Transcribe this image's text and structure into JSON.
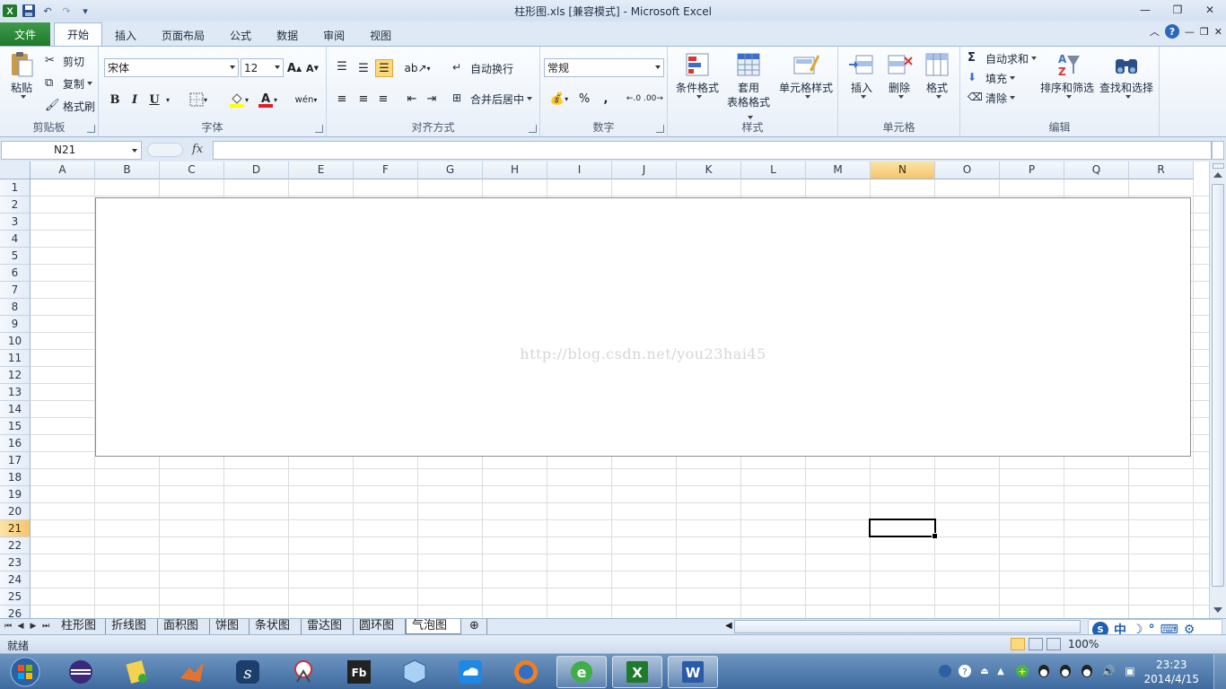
{
  "window": {
    "title": "柱形图.xls  [兼容模式]  -  Microsoft Excel",
    "controls": {
      "minimize": "—",
      "restore": "❐",
      "close": "✕"
    }
  },
  "ribbon_tabs": [
    "文件",
    "开始",
    "插入",
    "页面布局",
    "公式",
    "数据",
    "审阅",
    "视图"
  ],
  "clipboard": {
    "paste": "粘贴",
    "cut": "剪切",
    "copy": "复制",
    "format_painter": "格式刷",
    "label": "剪贴板"
  },
  "font": {
    "name": "宋体",
    "size": "12",
    "bold": "B",
    "italic": "I",
    "underline": "U",
    "label": "字体"
  },
  "alignment": {
    "wrap": "自动换行",
    "merge": "合并后居中",
    "label": "对齐方式"
  },
  "number": {
    "format": "常规",
    "percent": "%",
    "comma": ",",
    "label": "数字"
  },
  "styles": {
    "conditional": "条件格式",
    "table_line1": "套用",
    "table_line2": "表格格式",
    "cell_styles": "单元格样式",
    "label": "样式"
  },
  "cells": {
    "insert": "插入",
    "delete": "删除",
    "format": "格式",
    "label": "单元格"
  },
  "editing": {
    "autosum": "自动求和",
    "fill": "填充",
    "clear": "清除",
    "sort": "排序和筛选",
    "find": "查找和选择",
    "label": "编辑"
  },
  "formula_bar": {
    "name_box": "N21",
    "fx": "fx",
    "value": ""
  },
  "grid": {
    "columns": [
      "A",
      "B",
      "C",
      "D",
      "E",
      "F",
      "G",
      "H",
      "I",
      "J",
      "K",
      "L",
      "M",
      "N",
      "O",
      "P",
      "Q",
      "R"
    ],
    "selected_column": "N",
    "rows": [
      "1",
      "2",
      "3",
      "4",
      "5",
      "6",
      "7",
      "8",
      "9",
      "10",
      "11",
      "12",
      "13",
      "14",
      "15",
      "16",
      "17",
      "18",
      "19",
      "20",
      "21",
      "22",
      "23",
      "24",
      "25",
      "26"
    ],
    "selected_row": "21"
  },
  "chart": {
    "watermark": "http://blog.csdn.net/you23hai45"
  },
  "sheets": [
    "柱形图",
    "折线图",
    "面积图",
    "饼图",
    "条状图",
    "雷达图",
    "圆环图",
    "气泡图"
  ],
  "active_sheet": "气泡图",
  "status": {
    "ready": "就绪",
    "zoom": "100%"
  },
  "ime": {
    "mode": "中"
  },
  "taskbar": {
    "time": "23:23",
    "date": "2014/4/15"
  }
}
